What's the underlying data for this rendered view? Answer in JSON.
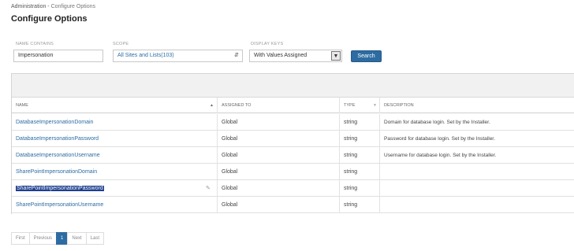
{
  "breadcrumb": {
    "parent": "Administration",
    "separator": " - ",
    "current": "Configure Options"
  },
  "page_title": "Configure Options",
  "filters": {
    "name_contains": {
      "label": "NAME CONTAINS",
      "value": "Impersonation"
    },
    "scope": {
      "label": "SCOPE",
      "value": "All Sites and Lists(103)"
    },
    "display_keys": {
      "label": "DISPLAY KEYS",
      "value": "With Values Assigned"
    },
    "search_label": "Search"
  },
  "table": {
    "headers": {
      "name": "NAME",
      "assigned_to": "ASSIGNED TO",
      "type": "TYPE",
      "description": "DESCRIPTION"
    },
    "rows": [
      {
        "name": "DatabaseImpersonationDomain",
        "assigned_to": "Global",
        "type": "string",
        "description": "Domain for database login. Set by the Installer."
      },
      {
        "name": "DatabaseImpersonationPassword",
        "assigned_to": "Global",
        "type": "string",
        "description": "Password for database login. Set by the Installer."
      },
      {
        "name": "DatabaseImpersonationUsername",
        "assigned_to": "Global",
        "type": "string",
        "description": "Username for database login. Set by the Installer."
      },
      {
        "name": "SharePointImpersonationDomain",
        "assigned_to": "Global",
        "type": "string",
        "description": ""
      },
      {
        "name": "SharePointImpersonationPassword",
        "assigned_to": "Global",
        "type": "string",
        "description": "",
        "selected": true
      },
      {
        "name": "SharePointImpersonationUsername",
        "assigned_to": "Global",
        "type": "string",
        "description": ""
      }
    ]
  },
  "pagination": {
    "first": "First",
    "previous": "Previous",
    "current_page": "1",
    "next": "Next",
    "last": "Last"
  },
  "icons": {
    "sort_name": "sort-up-icon",
    "sort_type": "sort-down-icon",
    "scope_arrow": "select-arrows-icon",
    "keys_arrow": "dropdown-arrow-icon",
    "edit": "pencil-icon"
  },
  "colors": {
    "accent": "#2d6ca2",
    "selection": "#1e3f8f"
  }
}
